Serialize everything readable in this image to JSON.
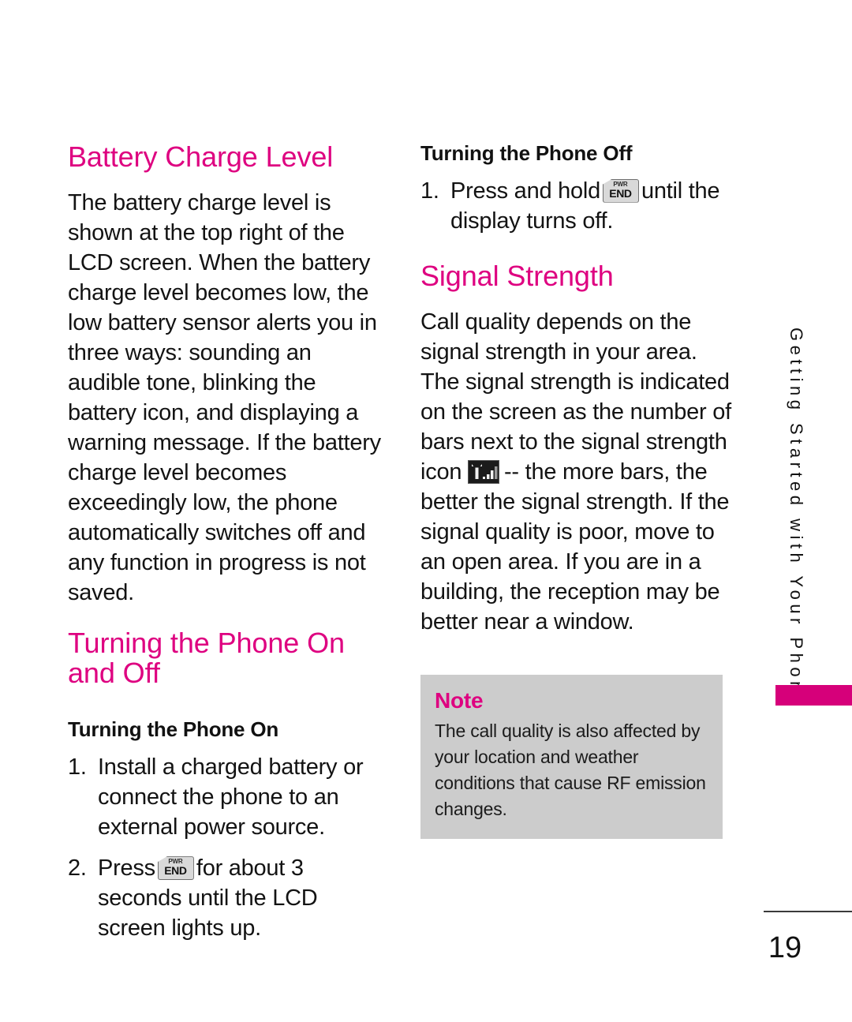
{
  "page": {
    "number": "19",
    "running_head": "Getting Started with Your Phone",
    "accent_color": "#DE0080",
    "note_bg_color": "#CCCCCC",
    "tab_color": "#D6007A"
  },
  "left_column": {
    "section1": {
      "heading": "Battery Charge Level",
      "paragraph": "The battery charge level is shown at the top right of the LCD screen. When the battery charge level becomes low, the low battery sensor alerts you in three ways: sounding an audible tone, blinking the battery icon, and displaying a warning message. If the battery charge level becomes exceedingly low, the phone automatically switches off and any function in progress is not saved."
    },
    "section2": {
      "heading": "Turning the Phone On and Off",
      "subheading": "Turning the Phone On",
      "steps": [
        {
          "number": "1.",
          "text_before": "Install a charged battery or connect the phone to an external power source.",
          "key": null,
          "text_after": ""
        },
        {
          "number": "2.",
          "text_before": "Press",
          "key": {
            "top": "PWR",
            "bottom": "END",
            "name": "pwr-end-key"
          },
          "text_after": "for about 3 seconds until the LCD screen lights up."
        }
      ]
    }
  },
  "right_column": {
    "section1": {
      "subheading": "Turning the Phone Off",
      "steps": [
        {
          "number": "1.",
          "text_before": "Press and hold",
          "key": {
            "top": "PWR",
            "bottom": "END",
            "name": "pwr-end-key"
          },
          "text_after": "until the display turns off."
        }
      ]
    },
    "section2": {
      "heading": "Signal Strength",
      "paragraph_part1": "Call quality depends on the signal strength in your area. The signal strength is indicated on the screen as the number of bars next to the signal strength icon",
      "icon_name": "signal-strength-icon",
      "paragraph_part2": "-- the more bars, the better the signal strength. If the signal quality is poor, move to an open area. If you are in a building, the reception may be better near a window."
    },
    "note": {
      "title": "Note",
      "body": "The call quality is also affected by your location and weather conditions that cause RF emission changes."
    }
  }
}
